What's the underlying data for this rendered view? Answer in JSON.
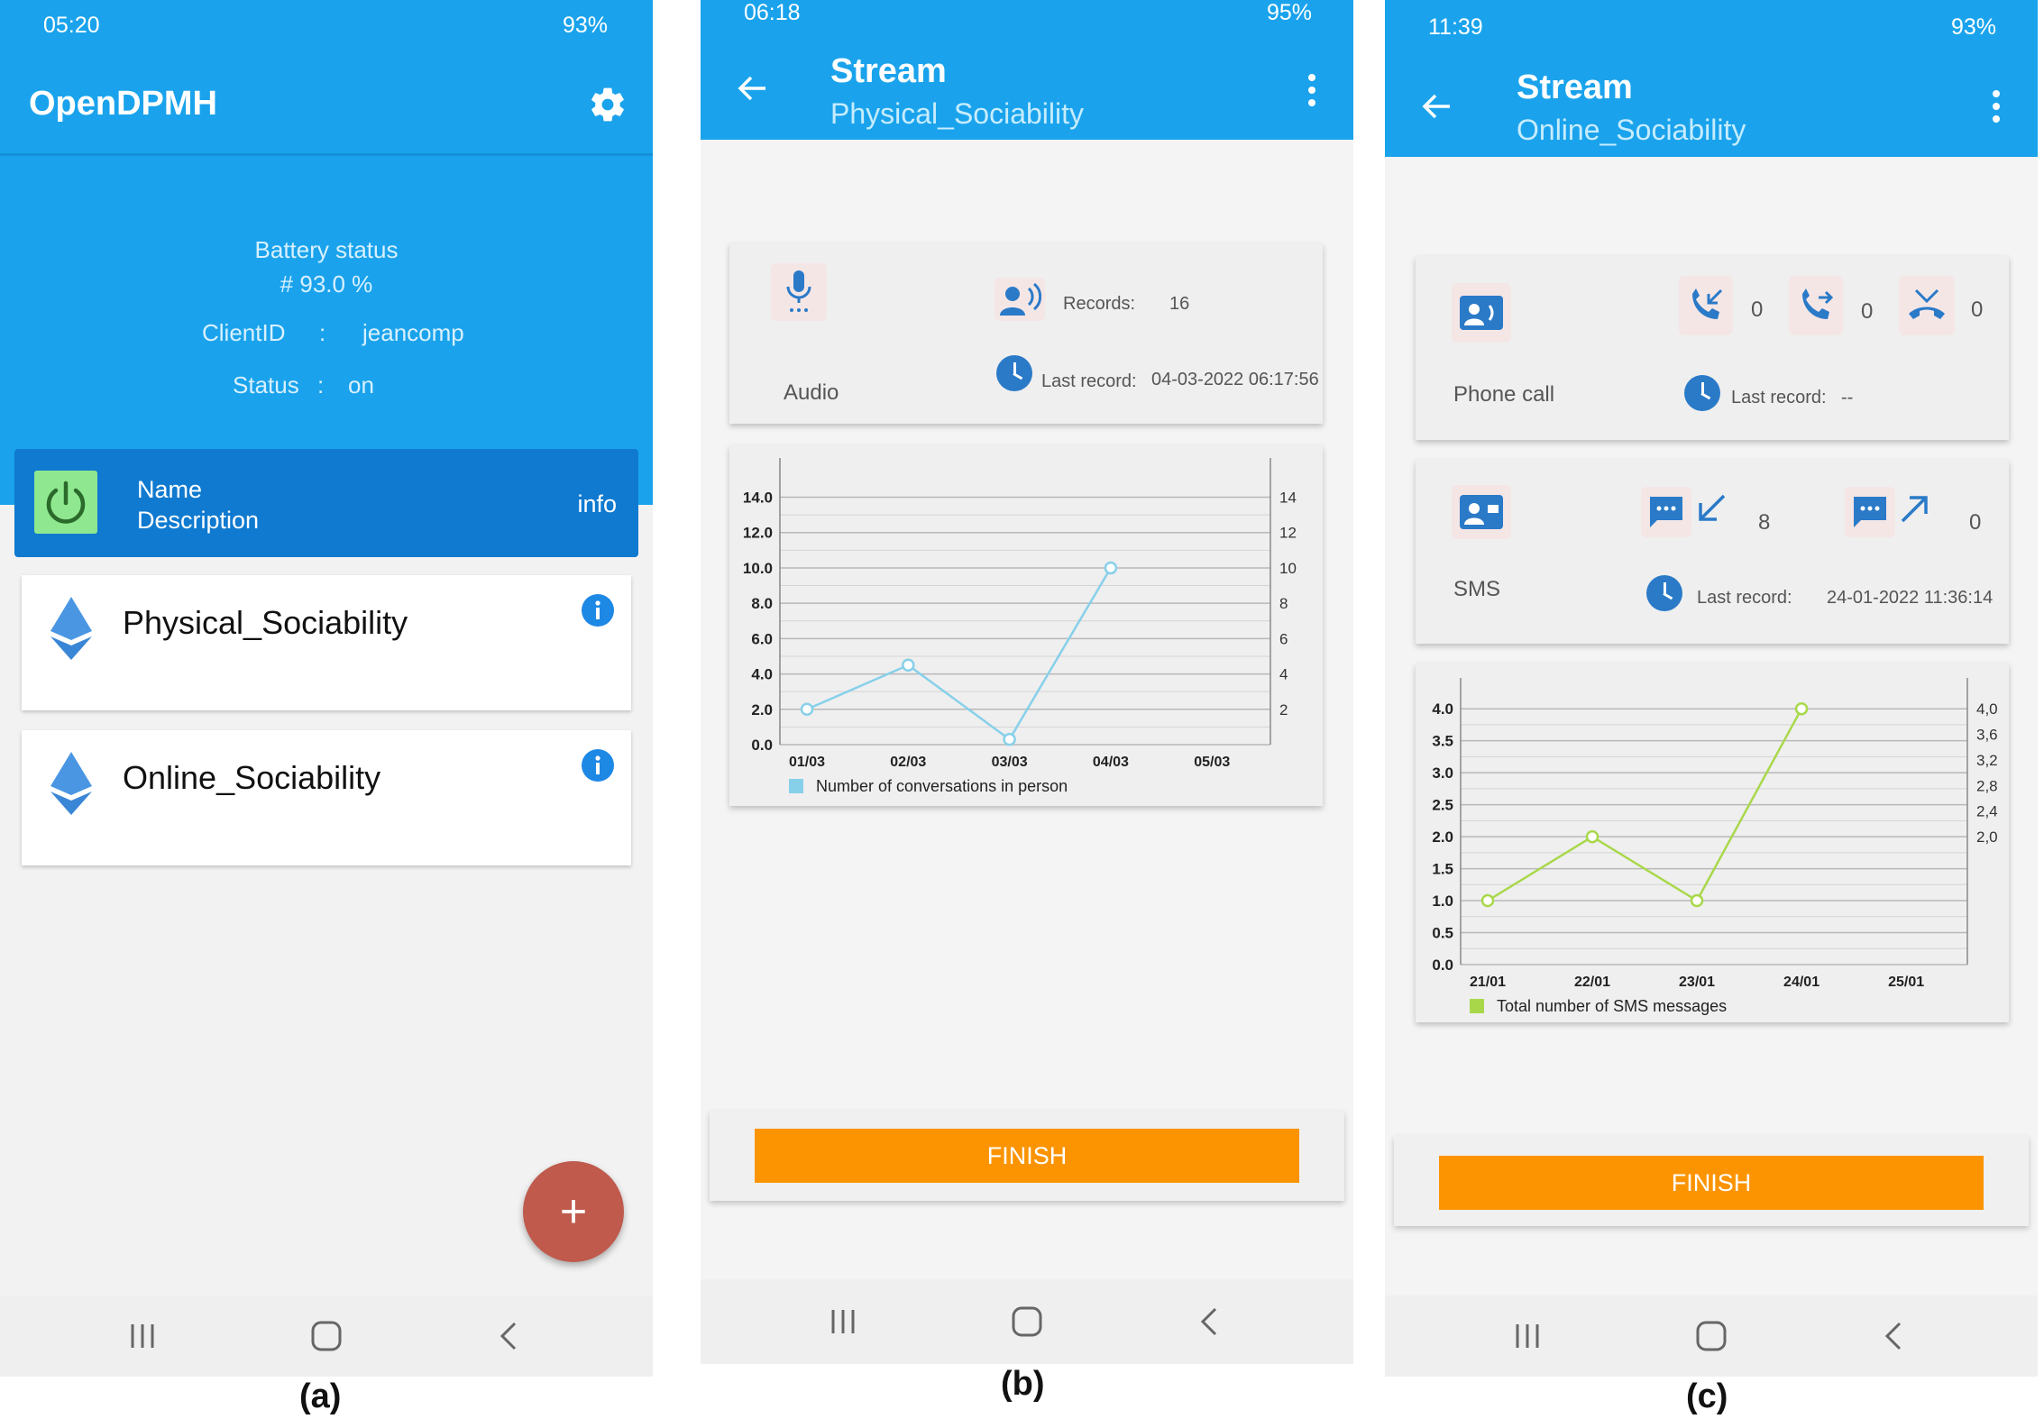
{
  "labels": {
    "a": "(a)",
    "b": "(b)",
    "c": "(c)"
  },
  "screen_a": {
    "status": {
      "time": "05:20",
      "right": "93%"
    },
    "app_title": "OpenDPMH",
    "battery_label": "Battery status",
    "battery_value": "# 93.0 %",
    "client_label": "ClientID",
    "client_sep": ":",
    "client_value": "jeancomp",
    "status_label": "Status",
    "status_sep": ":",
    "status_value": "on",
    "header_name": "Name",
    "header_desc": "Description",
    "header_info": "info",
    "items": [
      {
        "label": "Physical_Sociability"
      },
      {
        "label": "Online_Sociability"
      }
    ],
    "fab": "+"
  },
  "screen_b": {
    "status": {
      "time": "06:18",
      "right": "95%"
    },
    "title": "Stream",
    "subtitle": "Physical_Sociability",
    "sensor_label": "Audio",
    "records_label": "Records:",
    "records_value": "16",
    "last_label": "Last record:",
    "last_value": "04-03-2022 06:17:56",
    "finish": "FINISH"
  },
  "screen_c": {
    "status": {
      "time": "11:39",
      "right": "93%"
    },
    "title": "Stream",
    "subtitle": "Online_Sociability",
    "phone_label": "Phone call",
    "call_in": "0",
    "call_out": "0",
    "call_missed": "0",
    "phone_last_label": "Last record:",
    "phone_last_value": "--",
    "sms_label": "SMS",
    "sms_in": "8",
    "sms_out": "0",
    "sms_last_label": "Last record:",
    "sms_last_value": "24-01-2022 11:36:14",
    "finish": "FINISH"
  },
  "colors": {
    "primary": "#1aa3ec",
    "header_dark": "#0f7ad0",
    "accent_orange": "#fb9400",
    "fab": "#bf5a4d",
    "chart_b": "#87d0ea",
    "chart_c": "#a8d84a"
  },
  "chart_data": [
    {
      "type": "line",
      "categories": [
        "01/03",
        "02/03",
        "03/03",
        "04/03",
        "05/03"
      ],
      "series": [
        {
          "name": "Number of conversations in person",
          "values": [
            2,
            4.5,
            0.3,
            10,
            null
          ]
        }
      ],
      "y_left_ticks": [
        "0.0",
        "2.0",
        "4.0",
        "6.0",
        "8.0",
        "10.0",
        "12.0",
        "14.0"
      ],
      "y_right_ticks": [
        "2",
        "4",
        "6",
        "8",
        "10",
        "12",
        "14"
      ],
      "ylim": [
        0,
        15.2
      ],
      "grid": true,
      "legend": "bottom"
    },
    {
      "type": "line",
      "categories": [
        "21/01",
        "22/01",
        "23/01",
        "24/01",
        "25/01"
      ],
      "series": [
        {
          "name": "Total number of SMS messages",
          "values": [
            1,
            2,
            1,
            4,
            null
          ]
        }
      ],
      "y_left_ticks": [
        "0.0",
        "0.5",
        "1.0",
        "1.5",
        "2.0",
        "2.5",
        "3.0",
        "3.5",
        "4.0"
      ],
      "y_right_ticks": [
        "2,0",
        "2,4",
        "2,8",
        "3,2",
        "3,6",
        "4,0"
      ],
      "ylim": [
        0,
        4.2
      ],
      "grid": true,
      "legend": "bottom"
    }
  ]
}
